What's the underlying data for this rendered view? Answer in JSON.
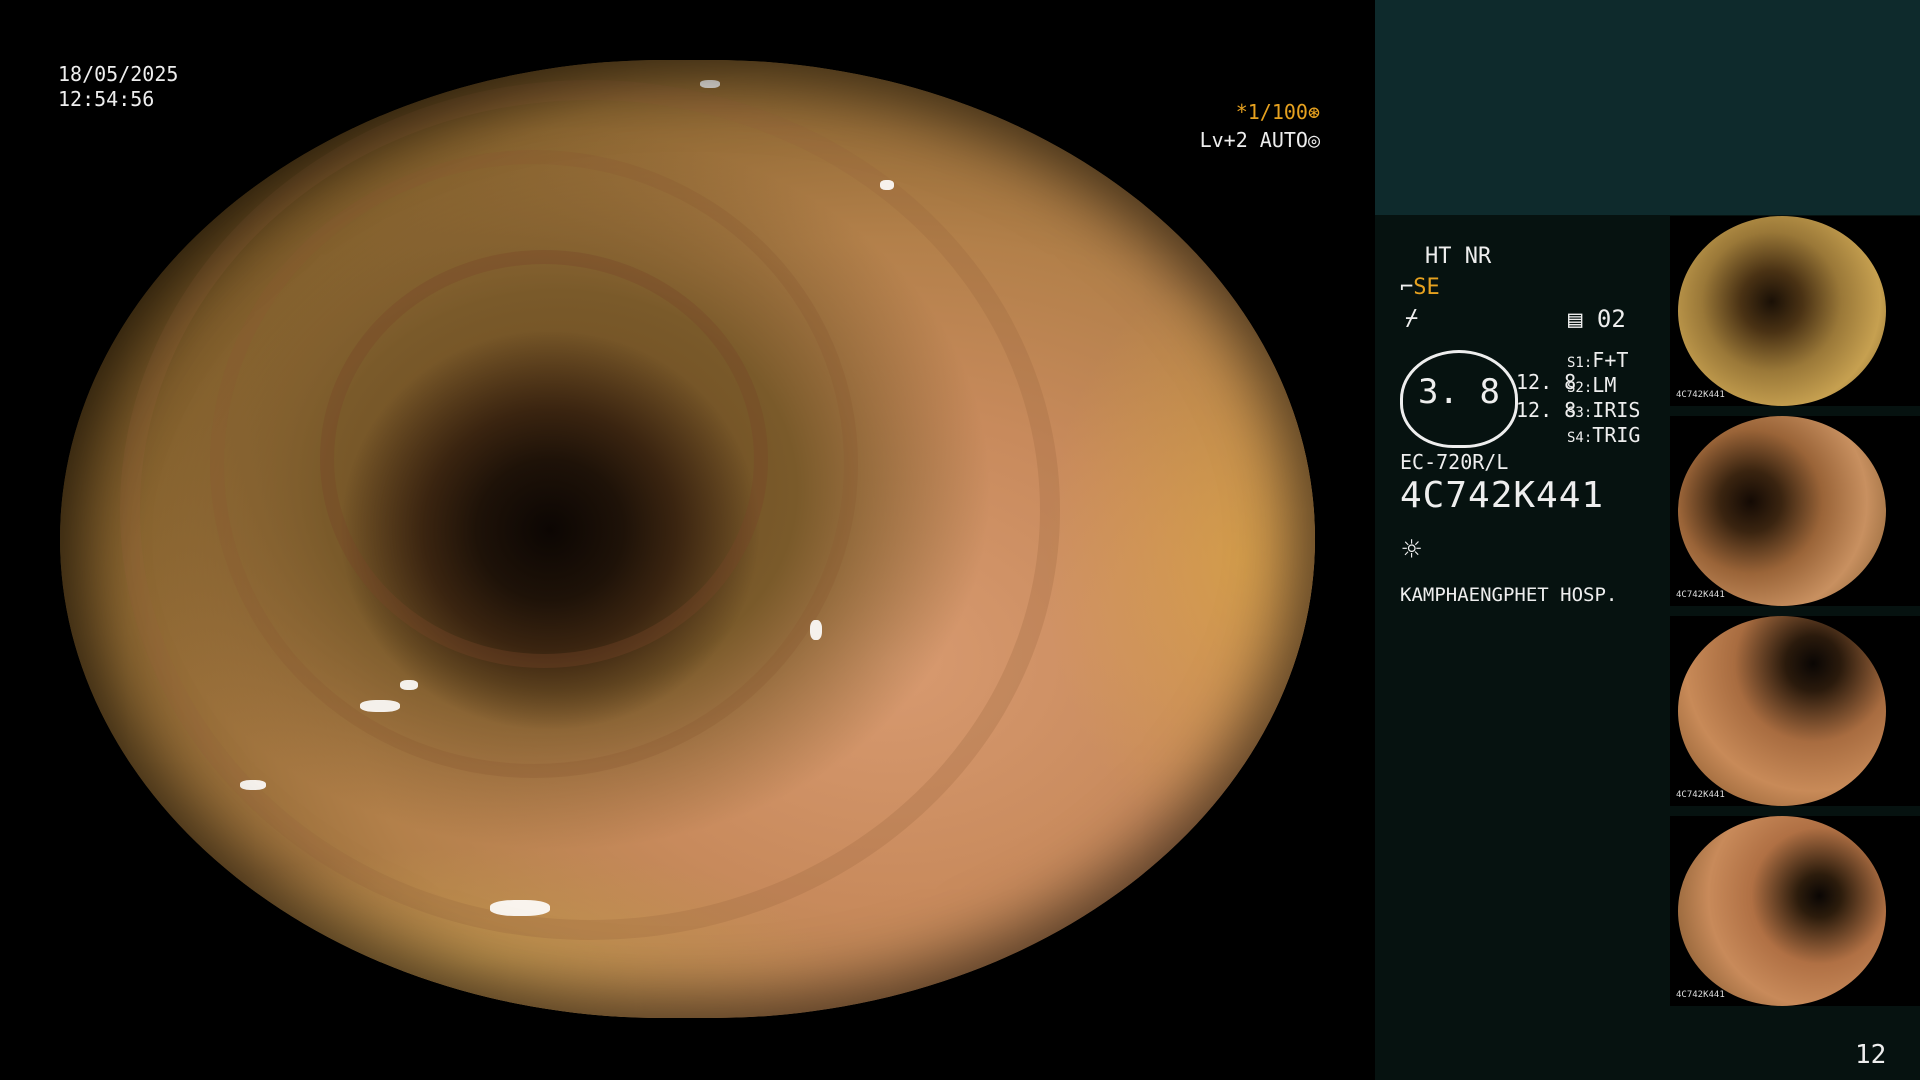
{
  "overlay": {
    "date": "18/05/2025",
    "time": "12:54:56",
    "shutter": "*1/100",
    "shutter_icon": "aperture-icon",
    "level": "Lv+2 AUTO",
    "level_icon": "target-icon"
  },
  "panel": {
    "mode_ht": "HT NR",
    "mode_se": "SE",
    "mode_f": "⌿",
    "counter": "02",
    "gauge_value": "3. 8",
    "gauge_side_1": "12. 8",
    "gauge_side_2": "12. 8",
    "switches": [
      {
        "key": "S1:",
        "value": "F+T"
      },
      {
        "key": "S2:",
        "value": "LM"
      },
      {
        "key": "S3:",
        "value": "IRIS"
      },
      {
        "key": "S4:",
        "value": "TRIG"
      }
    ],
    "model": "EC-720R/L",
    "serial": "4C742K441",
    "light_icon": "sun-icon",
    "hospital": "KAMPHAENGPHET HOSP.",
    "page_number": "12"
  },
  "thumbnails": [
    {
      "caption": "4C742K441"
    },
    {
      "caption": "4C742K441"
    },
    {
      "caption": "4C742K441"
    },
    {
      "caption": "4C742K441"
    }
  ],
  "colors": {
    "accent": "#e6a11f",
    "panel_top": "#0e2a2c",
    "panel_side": "#061210"
  }
}
